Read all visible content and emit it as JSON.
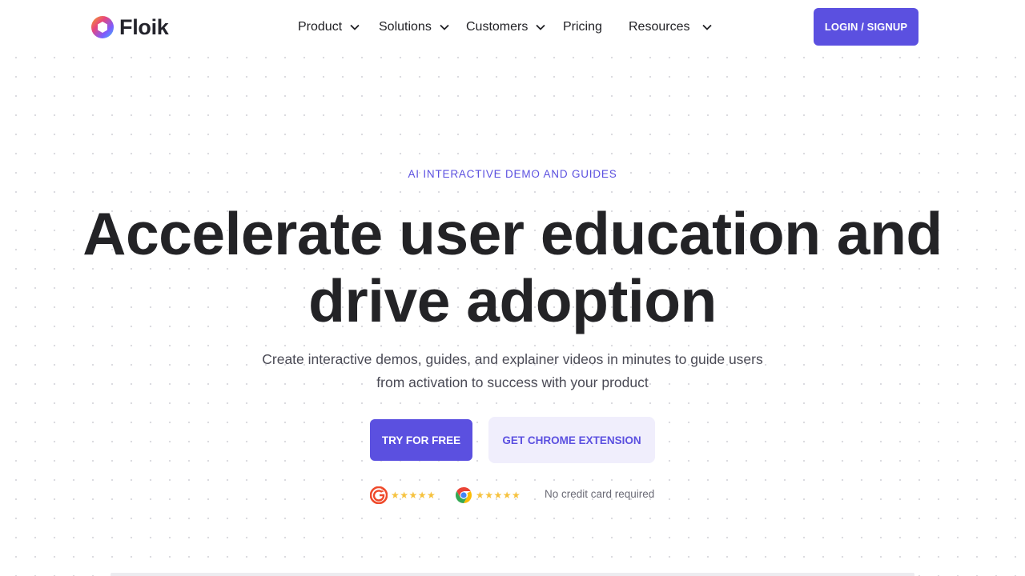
{
  "brand": {
    "name": "Floik",
    "icon": "floik-logo-icon"
  },
  "nav": {
    "items": [
      {
        "label": "Product",
        "has_dropdown": true
      },
      {
        "label": "Solutions",
        "has_dropdown": true
      },
      {
        "label": "Customers",
        "has_dropdown": true
      },
      {
        "label": "Pricing",
        "has_dropdown": false
      },
      {
        "label": "Resources",
        "has_dropdown": true
      }
    ],
    "login_label": "LOGIN / SIGNUP"
  },
  "hero": {
    "eyebrow": "AI INTERACTIVE DEMO AND GUIDES",
    "headline_line1": "Accelerate user education and",
    "headline_line2": "drive adoption",
    "sub_line1": "Create interactive demos, guides, and explainer videos in minutes to guide users",
    "sub_line2": "from activation to success with your product",
    "cta_primary": "TRY FOR FREE",
    "cta_secondary": "GET CHROME EXTENSION"
  },
  "ratings": {
    "g2": {
      "icon": "g2-logo-icon",
      "stars": "★★★★★",
      "rating": 5
    },
    "chrome": {
      "icon": "chrome-logo-icon",
      "stars": "★★★★★",
      "rating": 4.5
    },
    "note": "No credit card required"
  },
  "colors": {
    "accent": "#5b50e0",
    "accent_light": "#f0eefc",
    "star": "#f6c23e",
    "heading": "#232326"
  }
}
